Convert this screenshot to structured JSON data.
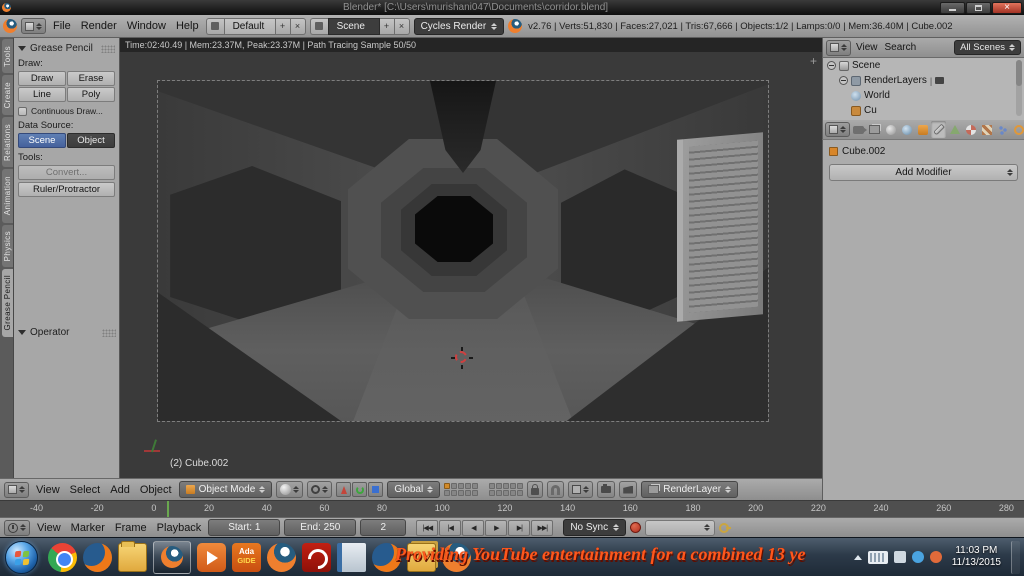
{
  "titlebar": {
    "title": "Blender* [C:\\Users\\murishani047\\Documents\\corridor.blend]",
    "close_glyph": "×"
  },
  "infobar": {
    "menus": [
      "File",
      "Render",
      "Window",
      "Help"
    ],
    "layout_value": "Default",
    "scene_value": "Scene",
    "engine_value": "Cycles Render",
    "stats": "v2.76 | Verts:51,830 | Faces:27,021 | Tris:67,666 | Objects:1/2 | Lamps:0/0 | Mem:36.40M | Cube.002",
    "plus_glyph": "+",
    "x_glyph": "×"
  },
  "toolshelf": {
    "tabs": [
      "Tools",
      "Create",
      "Relations",
      "Animation",
      "Physics",
      "Grease Pencil"
    ],
    "active_tab": "Grease Pencil",
    "panel_title": "Grease Pencil",
    "draw_label": "Draw:",
    "draw_buttons": [
      "Draw",
      "Erase",
      "Line",
      "Poly"
    ],
    "continuous_draw": "Continuous Draw...",
    "data_source_label": "Data Source:",
    "source_buttons": [
      "Scene",
      "Object"
    ],
    "tools_label": "Tools:",
    "convert_button": "Convert...",
    "ruler_button": "Ruler/Protractor",
    "operator_title": "Operator"
  },
  "viewport": {
    "render_stats": "Time:02:40.49 | Mem:23.37M, Peak:23.37M | Path Tracing Sample 50/50",
    "object_info": "(2) Cube.002",
    "n_panel_toggle": "+"
  },
  "outliner": {
    "menus": [
      "View",
      "Search"
    ],
    "scenes_filter": "All Scenes",
    "rows": [
      {
        "label": "Scene"
      },
      {
        "label": "RenderLayers",
        "suffix": "|"
      },
      {
        "label": "World"
      },
      {
        "label": "Cu"
      }
    ]
  },
  "properties": {
    "breadcrumb_object": "Cube.002",
    "add_modifier_button": "Add Modifier"
  },
  "viewport_header": {
    "menus": [
      "View",
      "Select",
      "Add",
      "Object"
    ],
    "mode_selector": "Object Mode",
    "orientation_selector": "Global",
    "render_layer_selector": "RenderLayer"
  },
  "timeline": {
    "ruler_ticks": [
      "-40",
      "-20",
      "0",
      "20",
      "40",
      "60",
      "80",
      "100",
      "120",
      "140",
      "160",
      "180",
      "200",
      "220",
      "240",
      "260",
      "280"
    ],
    "menus": [
      "View",
      "Marker",
      "Frame",
      "Playback"
    ],
    "start_field": "Start: 1",
    "end_field": "End: 250",
    "current_frame": "2",
    "playback_glyphs": [
      "|◀◀",
      "|◀",
      "◀",
      "▶",
      "▶|",
      "▶▶|"
    ],
    "sync_selector": "No Sync"
  },
  "taskbar": {
    "marquee_text": "Providing YouTube entertainment for a combined 13 ye",
    "ada_line1": "Ada",
    "ada_line2": "GIDE",
    "clock_time": "11:03 PM",
    "clock_date": "11/13/2015"
  }
}
